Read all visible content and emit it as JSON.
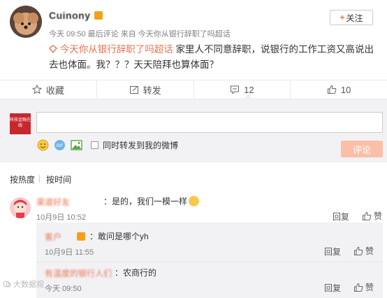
{
  "post": {
    "username": "Cuinony",
    "meta_time": "今天 09:50",
    "meta_mid": "最后评论 来自",
    "meta_topic": "今天你从银行辞职了吗超话",
    "follow_label": "关注",
    "topic_tag": "今天你从银行辞职了吗超话",
    "content": " 家里人不同意辞职，说银行的工作工资又高说出去也体面。我？？？天天陪拜也算体面？"
  },
  "actions": {
    "favorite": "收藏",
    "repost": "转发",
    "comment": "12",
    "like": "10"
  },
  "compose": {
    "avatar_text": "科技金融在线",
    "checkbox_label": "同时转发到我的微博",
    "submit_label": "评论"
  },
  "sort": {
    "by_hot": "按热度",
    "by_time": "按时间"
  },
  "comments": [
    {
      "name": "渠道好友",
      "text": "：是的，我们一模一样",
      "time": "10月9日 10:52",
      "reply": "回复",
      "like": "赞"
    }
  ],
  "sub_comments": [
    {
      "name": "客户",
      "text": "：敢问是哪个yh",
      "time": "10月9日 11:55",
      "reply": "回复",
      "like": "赞"
    },
    {
      "name": "有温度的银行人们",
      "text": "：农商行的",
      "time": "今天 09:50",
      "reply": "回复",
      "like": "赞"
    }
  ],
  "watermark": "大数据观"
}
